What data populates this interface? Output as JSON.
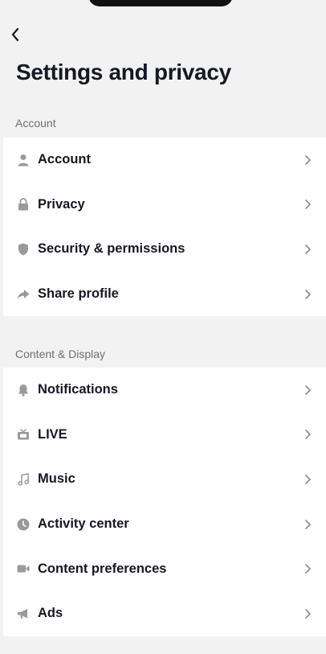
{
  "header": {
    "back_icon": "chevron-left-icon",
    "title": "Settings and privacy"
  },
  "sections": [
    {
      "label": "Account",
      "items": [
        {
          "label": "Account",
          "icon": "person-icon"
        },
        {
          "label": "Privacy",
          "icon": "lock-icon"
        },
        {
          "label": "Security & permissions",
          "icon": "shield-icon"
        },
        {
          "label": "Share profile",
          "icon": "share-icon"
        }
      ]
    },
    {
      "label": "Content & Display",
      "items": [
        {
          "label": "Notifications",
          "icon": "bell-icon"
        },
        {
          "label": "LIVE",
          "icon": "tv-icon"
        },
        {
          "label": "Music",
          "icon": "music-note-icon"
        },
        {
          "label": "Activity center",
          "icon": "clock-icon"
        },
        {
          "label": "Content preferences",
          "icon": "video-camera-icon"
        },
        {
          "label": "Ads",
          "icon": "megaphone-icon"
        }
      ]
    }
  ],
  "colors": {
    "background": "#f2f2f2",
    "row_background": "#ffffff",
    "text": "#161823",
    "secondary_text": "#6f6f73",
    "icon": "#9a9a9e"
  }
}
